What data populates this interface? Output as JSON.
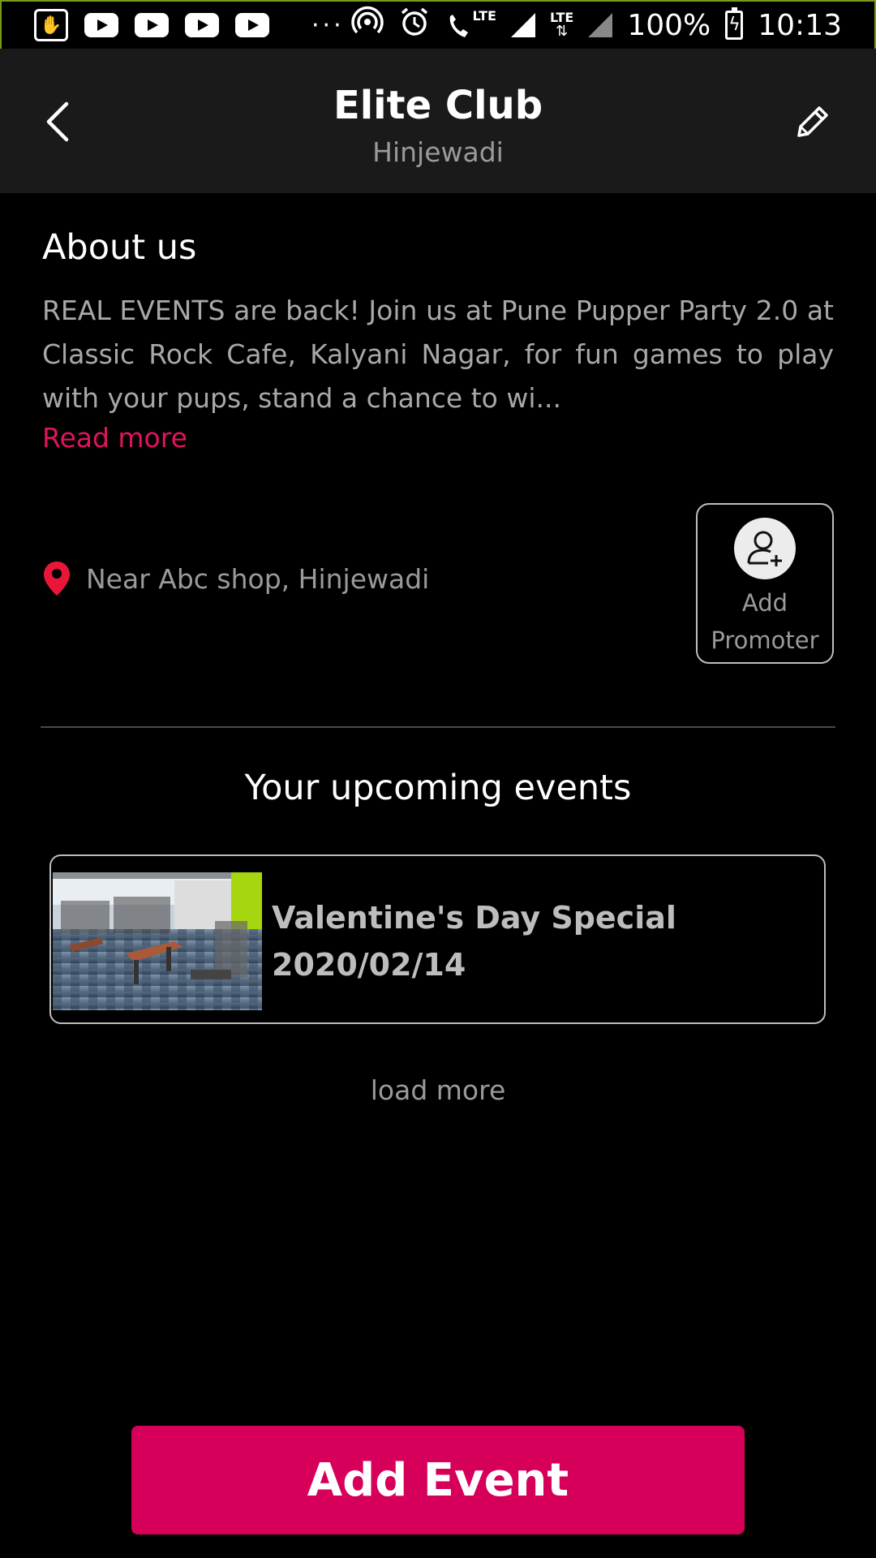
{
  "status_bar": {
    "app_icon": "hand-touch-icon",
    "dots": "···",
    "lte_label_1": "LTE",
    "lte_label_2": "LTE",
    "battery": "100%",
    "time": "10:13"
  },
  "header": {
    "title": "Elite Club",
    "subtitle": "Hinjewadi",
    "back_icon": "back-arrow-icon",
    "edit_icon": "pencil-icon"
  },
  "about": {
    "heading": "About us",
    "text": "REAL EVENTS are back! Join us at Pune Pupper Party 2.0 at Classic Rock Cafe, Kalyani Nagar, for fun games to play with your pups, stand a chance to wi...",
    "read_more": "Read more"
  },
  "location": {
    "icon": "map-pin-icon",
    "text": "Near Abc shop, Hinjewadi"
  },
  "promoter": {
    "icon": "add-user-icon",
    "label_line1": "Add",
    "label_line2": "Promoter"
  },
  "events": {
    "section_title": "Your upcoming events",
    "items": [
      {
        "name": "Valentine's Day Special",
        "date": "2020/02/14"
      }
    ],
    "load_more": "load more"
  },
  "actions": {
    "add_event": "Add Event"
  },
  "colors": {
    "accent": "#d6005a",
    "link": "#e0145e",
    "pin": "#e8173a",
    "header_bg": "#1a1a1a",
    "background": "#000000"
  }
}
